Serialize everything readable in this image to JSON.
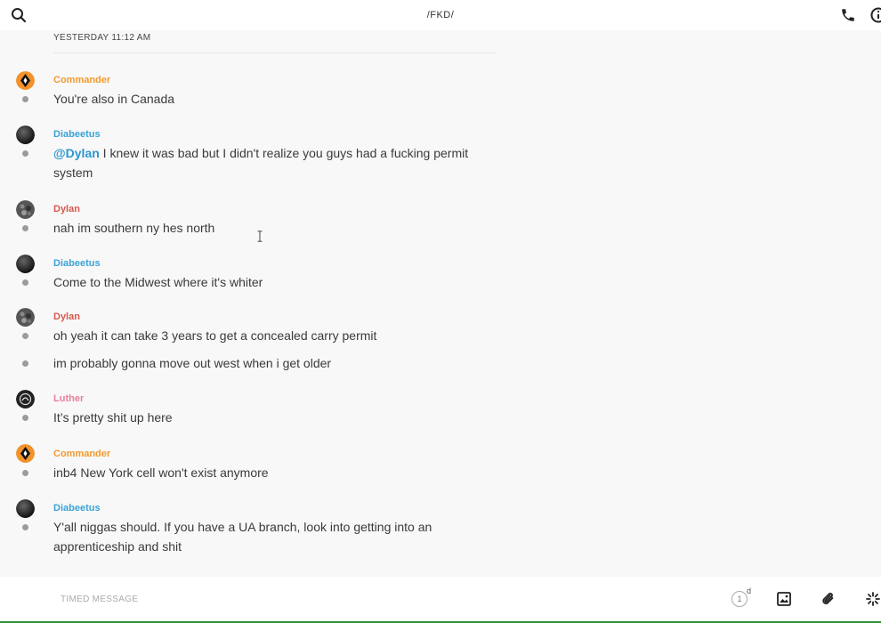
{
  "header": {
    "title": "/FKD/",
    "icons": [
      "search-icon",
      "phone-icon",
      "info-icon"
    ]
  },
  "timestamp": "YESTERDAY 11:12 AM",
  "messages": [
    {
      "author": "Commander",
      "avatar": "commander-avatar",
      "color": "#f29a2e",
      "lines": [
        "You're also in Canada"
      ]
    },
    {
      "author": "Diabeetus",
      "avatar": "diabeetus-avatar",
      "color": "#39a4d6",
      "mention": "@Dylan",
      "lines": [
        "I knew it was bad but I didn't realize you guys had a fucking permit",
        "system"
      ]
    },
    {
      "author": "Dylan",
      "avatar": "dylan-avatar",
      "color": "#d9574f",
      "lines": [
        "nah im southern ny hes north"
      ]
    },
    {
      "author": "Diabeetus",
      "avatar": "diabeetus-avatar",
      "color": "#39a4d6",
      "lines": [
        "Come to the Midwest where it's whiter"
      ]
    },
    {
      "author": "Dylan",
      "avatar": "dylan-avatar",
      "color": "#d9574f",
      "lines": [
        "oh yeah it can take 3 years to get a concealed carry permit",
        "im probably gonna move out west when i get older"
      ]
    },
    {
      "author": "Luther",
      "avatar": "luther-avatar",
      "color": "#e8809a",
      "lines": [
        "It’s pretty shit up here"
      ]
    },
    {
      "author": "Commander",
      "avatar": "commander-avatar",
      "color": "#f29a2e",
      "lines": [
        "inb4 New York cell won't exist anymore"
      ]
    },
    {
      "author": "Diabeetus",
      "avatar": "diabeetus-avatar",
      "color": "#39a4d6",
      "lines": [
        "Y'all niggas should. If you have a UA branch, look into getting into an",
        "apprenticeship and shit"
      ]
    }
  ],
  "composer": {
    "placeholder": "TIMED MESSAGE",
    "timer_value": "1",
    "timer_unit": "d",
    "icons": [
      "timer-icon",
      "image-icon",
      "paperclip-icon",
      "sparkle-icon"
    ]
  }
}
